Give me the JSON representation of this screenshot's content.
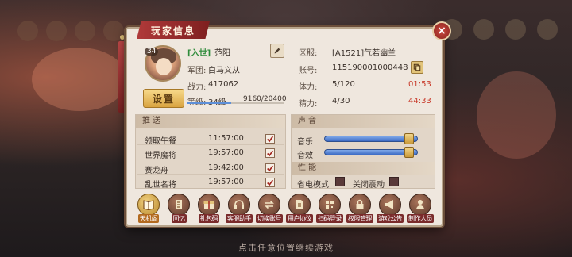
{
  "panel_title": "玩家信息",
  "close_label": "×",
  "player": {
    "avatar_level": "34",
    "tag": "[入世]",
    "name": "范阳",
    "guild_label": "军团:",
    "guild_value": "白马义从",
    "power_label": "战力:",
    "power_value": "417062",
    "level_label": "等级:",
    "level_value": "34级",
    "exp_text": "9160/20400",
    "exp_progress": 0.449,
    "settings_label": "设置"
  },
  "account": {
    "server_label": "区服:",
    "server_value": "[A1521]气若幽兰",
    "account_label": "账号:",
    "account_value": "115190001000448",
    "stamina_label": "体力:",
    "stamina_value": "5/120",
    "stamina_timer": "01:53",
    "energy_label": "精力:",
    "energy_value": "4/30",
    "energy_timer": "44:33"
  },
  "push": {
    "header": "推送",
    "items": [
      {
        "label": "领取午餐",
        "time": "11:57:00",
        "checked": true
      },
      {
        "label": "世界魔将",
        "time": "19:57:00",
        "checked": true
      },
      {
        "label": "赛龙舟",
        "time": "19:42:00",
        "checked": true
      },
      {
        "label": "乱世名将",
        "time": "19:57:00",
        "checked": true
      }
    ]
  },
  "sound": {
    "header": "声音",
    "music_label": "音乐",
    "music_level": 0.95,
    "sfx_label": "音效",
    "sfx_level": 0.95
  },
  "performance": {
    "header": "性能",
    "power_save_label": "省电模式",
    "vibration_label": "关闭震动"
  },
  "bottom_buttons": [
    {
      "label": "天机阁",
      "icon": "book-icon",
      "active": true
    },
    {
      "label": "回忆",
      "icon": "scroll-icon",
      "active": false
    },
    {
      "label": "礼包码",
      "icon": "gift-code-icon",
      "active": false
    },
    {
      "label": "客服助手",
      "icon": "headset-icon",
      "active": false
    },
    {
      "label": "切换账号",
      "icon": "switch-icon",
      "active": false
    },
    {
      "label": "用户协议",
      "icon": "document-icon",
      "active": false
    },
    {
      "label": "扫码登录",
      "icon": "qr-scan-icon",
      "active": false
    },
    {
      "label": "权限管理",
      "icon": "lock-icon",
      "active": false
    },
    {
      "label": "游戏公告",
      "icon": "megaphone-icon",
      "active": false
    },
    {
      "label": "制作人员",
      "icon": "team-icon",
      "active": false
    }
  ],
  "bottom_hint": "点击任意位置继续游戏",
  "colors": {
    "accent_red": "#c83a2a",
    "tag_green": "#2e8b3a",
    "panel_bg": "#efe7de",
    "gold": "#d9a441"
  }
}
